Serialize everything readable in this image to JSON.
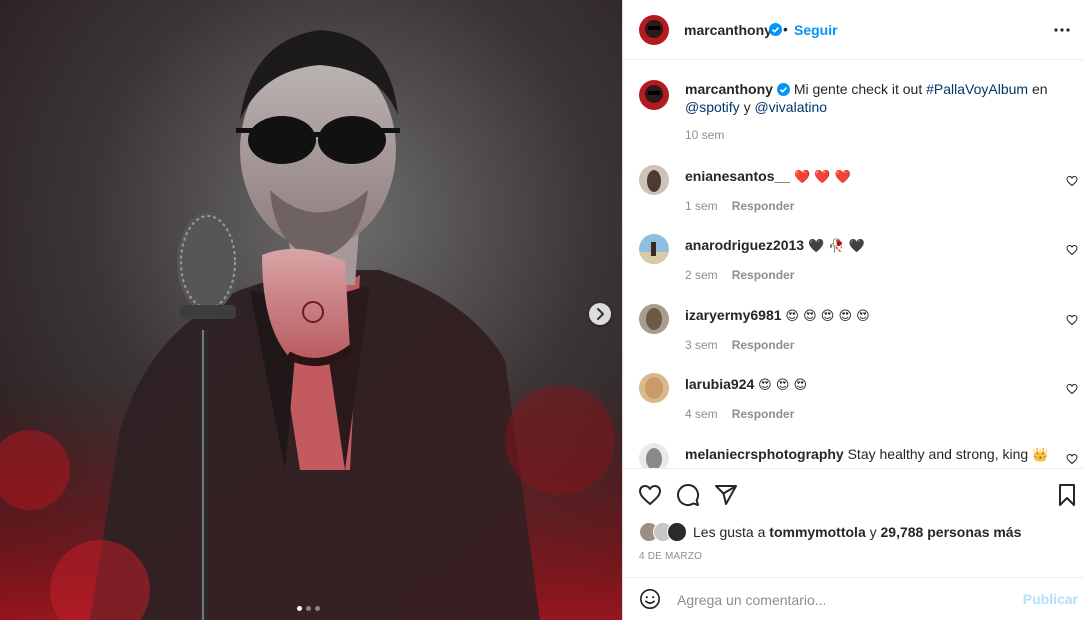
{
  "colors": {
    "accent": "#0095f6",
    "link": "#00376b",
    "muted": "#8e8e8e",
    "heart_red": "#ed4956",
    "publish_disabled": "#b2dffc"
  },
  "header": {
    "username": "marcanthony",
    "separator": "•",
    "follow_label": "Seguir"
  },
  "caption": {
    "username": "marcanthony",
    "text_1": "Mi gente check it out ",
    "hashtag": "#PallaVoyAlbum",
    "text_2": " en ",
    "mention_1": "@spotify",
    "text_3": " y ",
    "mention_2": "@vivalatino",
    "time": "10 sem"
  },
  "comments": [
    {
      "username": "enianesantos__",
      "text": "",
      "emoji": "❤️ ❤️ ❤️",
      "time": "1 sem",
      "reply": "Responder"
    },
    {
      "username": "anarodriguez2013",
      "text": "",
      "emoji": "🖤 🥀 🖤",
      "time": "2 sem",
      "reply": "Responder"
    },
    {
      "username": "izaryermy6981",
      "text": "",
      "emoji": "😍 😍 😍 😍 😍",
      "time": "3 sem",
      "reply": "Responder"
    },
    {
      "username": "larubia924",
      "text": "",
      "emoji": "😍 😍 😍",
      "time": "4 sem",
      "reply": "Responder"
    },
    {
      "username": "melaniecrsphotography",
      "text": "Stay healthy and strong, king",
      "emoji": "👑",
      "time": "",
      "reply": ""
    }
  ],
  "likes": {
    "prefix": "Les gusta a ",
    "user": "tommymottola",
    "mid": " y ",
    "count": "29,788 personas más"
  },
  "date": "4 DE MARZO",
  "add_comment": {
    "placeholder": "Agrega un comentario...",
    "publish_label": "Publicar"
  },
  "carousel": {
    "slides": 3,
    "active_index": 0
  },
  "icons": [
    "more-icon",
    "verified-icon",
    "heart-icon",
    "comment-icon",
    "share-icon",
    "bookmark-icon",
    "emoji-icon",
    "chevron-right-icon"
  ]
}
